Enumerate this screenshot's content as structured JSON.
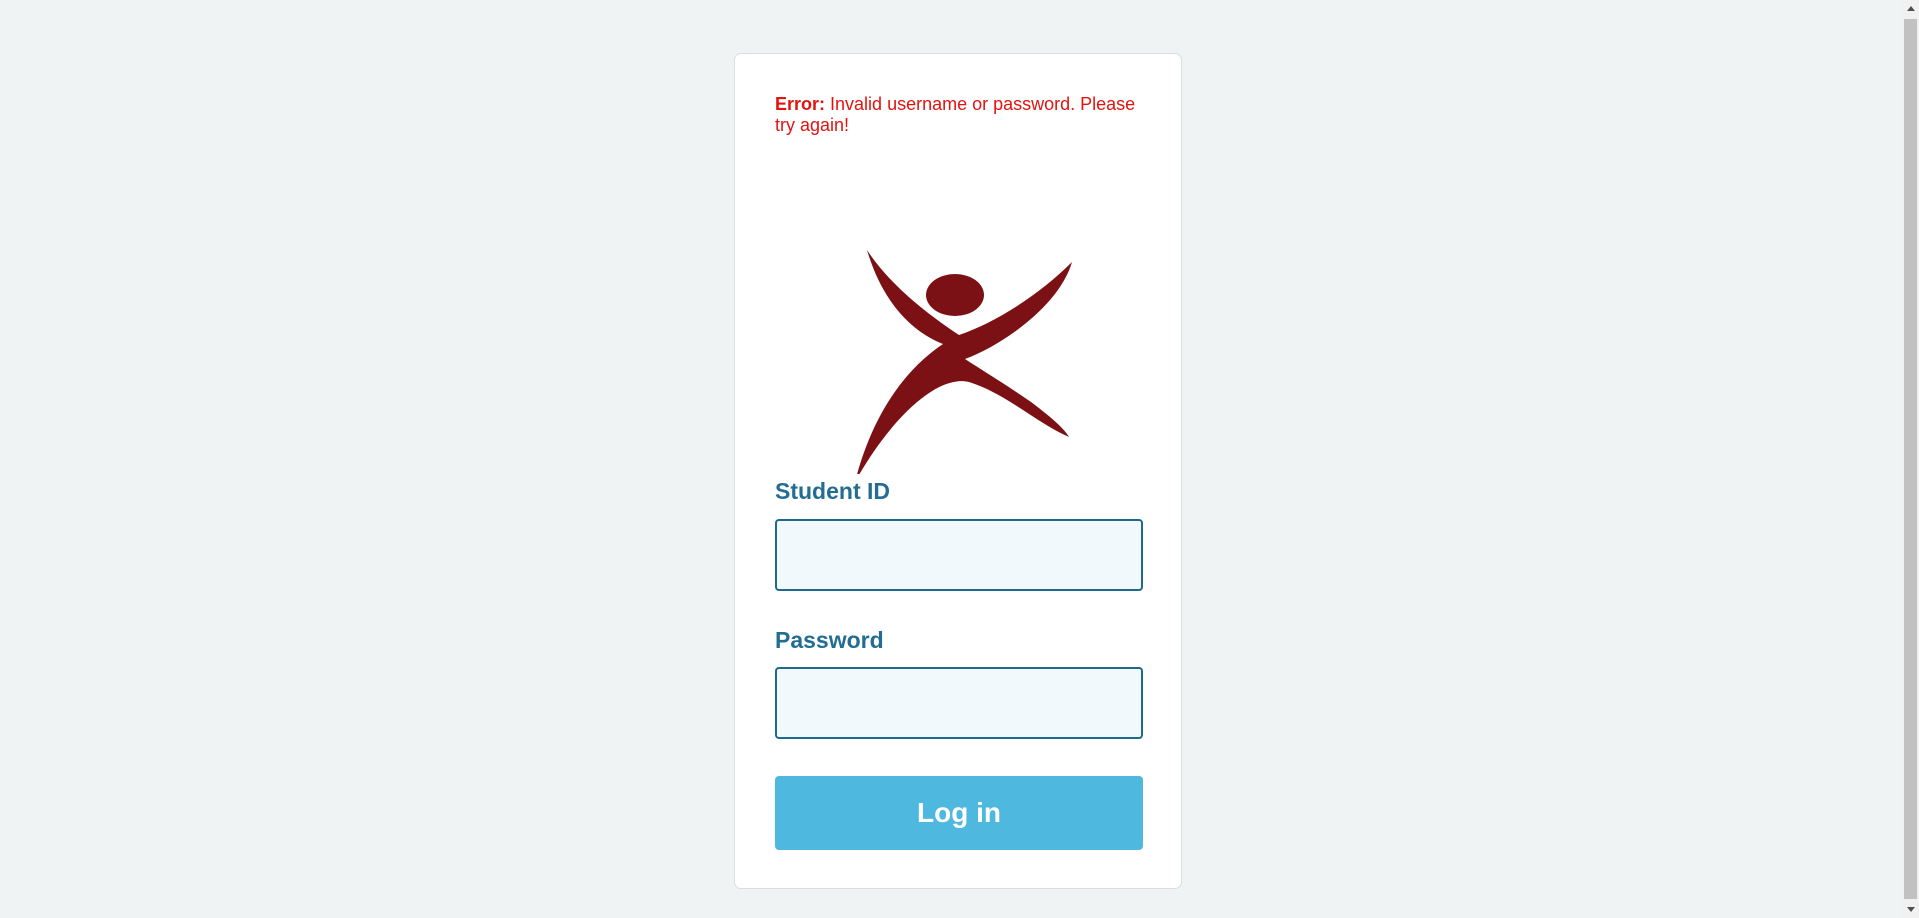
{
  "error": {
    "label": "Error:",
    "message": "Invalid username or password. Please try again!"
  },
  "logo": {
    "icon": "person-arms-raised-logo",
    "color": "#7b1114"
  },
  "form": {
    "student_id_label": "Student ID",
    "student_id_value": "",
    "password_label": "Password",
    "password_value": "",
    "login_button_label": "Log in"
  },
  "colors": {
    "background": "#eff3f4",
    "error": "#e3130f",
    "label": "#246d92",
    "input_border": "#1f6a8c",
    "input_bg": "#f2f9fc",
    "button": "#4fb8de"
  }
}
